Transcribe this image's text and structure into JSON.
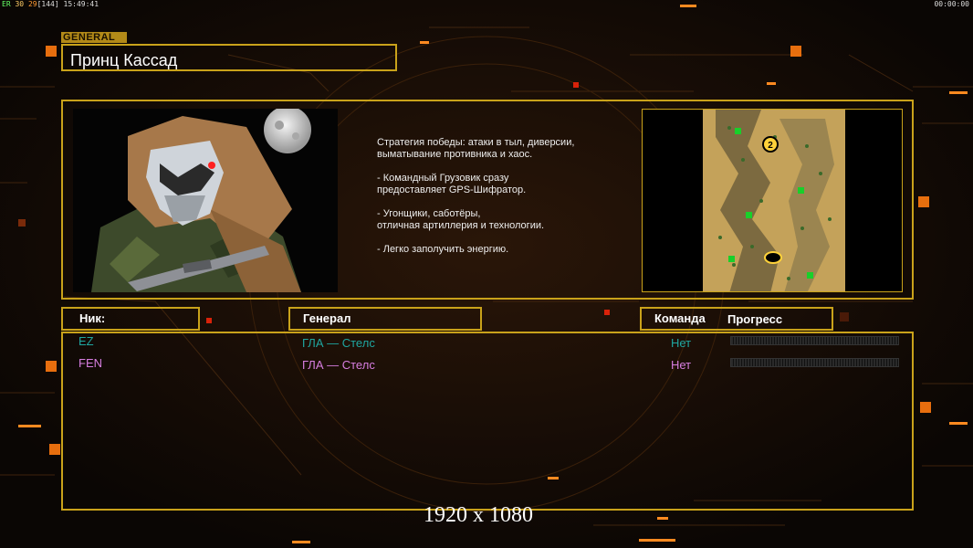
{
  "hud": {
    "top_left": {
      "a": "ER",
      "b": "30",
      "c": "29",
      "d": "[144]",
      "time": "15:49:41"
    },
    "top_right_time": "00:00:00"
  },
  "header": {
    "tag": "GENERAL",
    "title": "Принц Кассад"
  },
  "description": [
    "Стратегия победы: атаки в тыл, диверсии,",
    " выматывание противника и хаос.",
    "",
    "- Командный Грузовик сразу",
    "предоставляет GPS-Шифратор.",
    "",
    "- Угонщики, саботёры,",
    "отличная артиллерия и технологии.",
    "",
    "- Легко заполучить энергию."
  ],
  "columns": {
    "nick": "Ник:",
    "general": "Генерал",
    "team": "Команда",
    "progress": "Прогресс"
  },
  "players": [
    {
      "nick": "EZ",
      "general": "ГЛА — Стелс",
      "team": "Нет",
      "color": "#1fa6a0",
      "progress": 0
    },
    {
      "nick": "FEN",
      "general": "ГЛА — Стелс",
      "team": "Нет",
      "color": "#d77ee0",
      "progress": 0
    }
  ],
  "map_marker": "2",
  "footer_resolution": "1920 x 1080",
  "colors": {
    "accent": "#c9a21a",
    "orange": "#ff7a10",
    "red": "#d8220a"
  }
}
